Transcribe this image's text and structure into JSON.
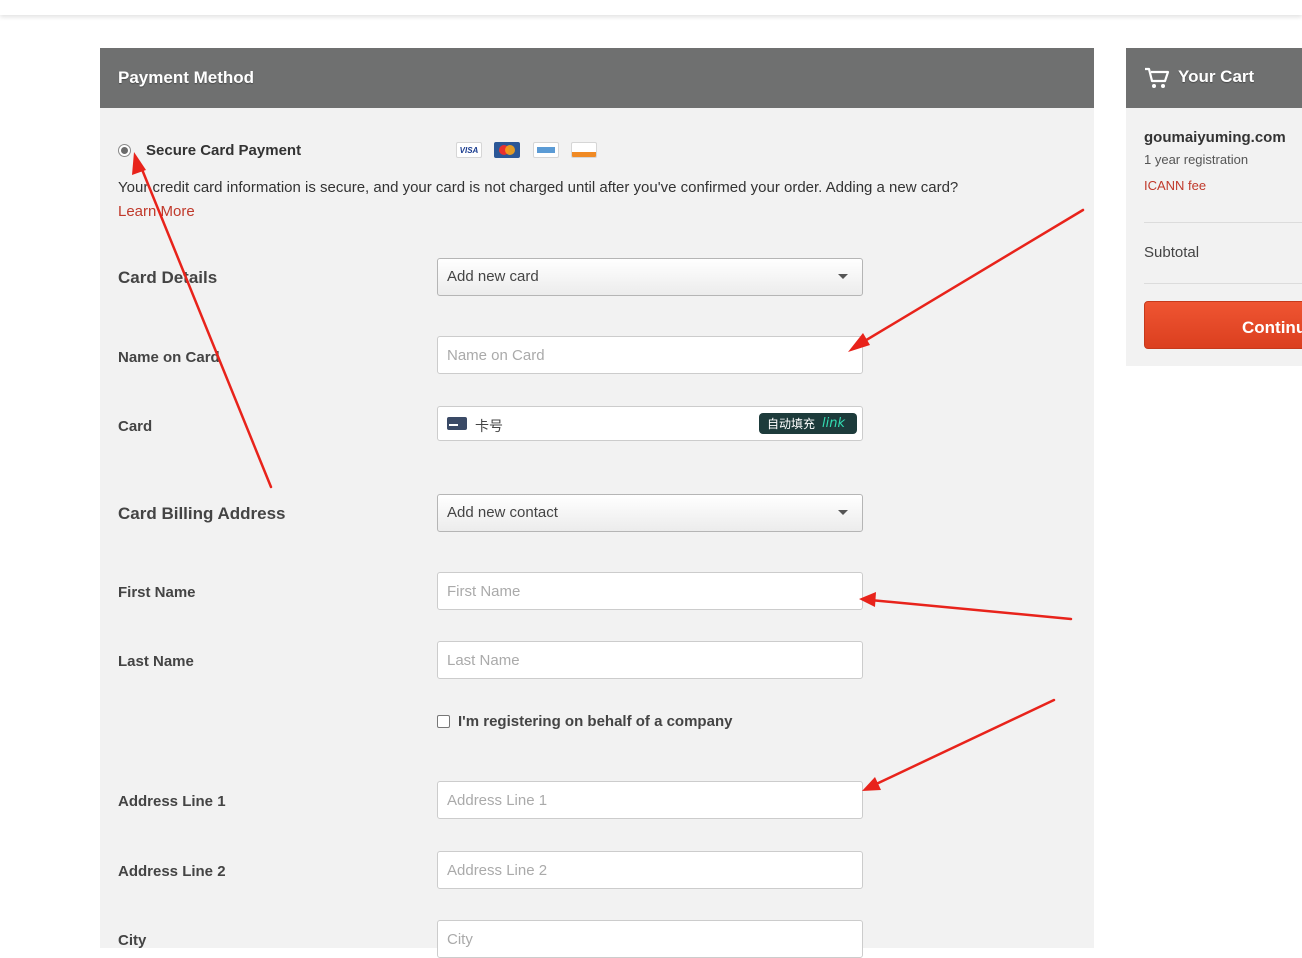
{
  "payment": {
    "header_title": "Payment Method",
    "option_label": "Secure Card Payment",
    "card_logos": [
      "VISA",
      "MasterCard",
      "AMEX",
      "DISCOVER"
    ],
    "info_text": "Your credit card information is secure, and your card is not charged until after you've confirmed your order. Adding a new card?",
    "learn_more": "Learn More"
  },
  "form": {
    "card_details_label": "Card Details",
    "card_select_value": "Add new card",
    "name_on_card_label": "Name on Card",
    "name_on_card_placeholder": "Name on Card",
    "card_label": "Card",
    "card_number_placeholder": "卡号",
    "autofill_label": "自动填充",
    "autofill_brand": "link",
    "billing_label": "Card Billing Address",
    "contact_select_value": "Add new contact",
    "first_name_label": "First Name",
    "first_name_placeholder": "First Name",
    "last_name_label": "Last Name",
    "last_name_placeholder": "Last Name",
    "company_checkbox_label": "I'm registering on behalf of a company",
    "address1_label": "Address Line 1",
    "address1_placeholder": "Address Line 1",
    "address2_label": "Address Line 2",
    "address2_placeholder": "Address Line 2",
    "city_label": "City",
    "city_placeholder": "City"
  },
  "cart": {
    "title": "Your Cart",
    "domain": "goumaiyuming.com",
    "term": "1 year registration",
    "fee": "ICANN fee",
    "subtotal_label": "Subtotal",
    "continue_label": "Continue"
  },
  "colors": {
    "header_bg": "#6f7070",
    "panel_bg": "#f2f2f2",
    "link_red": "#c0392b",
    "continue_orange": "#e84a27",
    "annotation_arrow": "#e8231b"
  }
}
